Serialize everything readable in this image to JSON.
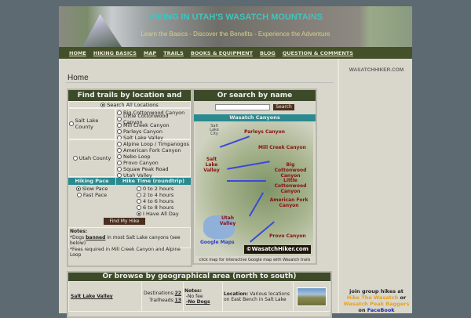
{
  "header": {
    "title": "HIKING IN UTAH'S WASATCH MOUNTAINS",
    "tagline": "Learn the Basics - Discover the Benefits - Experience the Adventure"
  },
  "nav": [
    "HOME",
    "HIKING BASICS",
    "MAP",
    "TRAILS",
    "BOOKS & EQUIPMENT",
    "BLOG",
    "QUESTION & COMMENTS"
  ],
  "page_title": "Home",
  "finder": {
    "title": "Find trails by location and time",
    "all": "Search All Locations",
    "slc": {
      "label": "Salt Lake County",
      "options": [
        "Big Cottonwood Canyon",
        "Little Cottonwood Canyon",
        "Mill Creek Canyon",
        "Parleys Canyon",
        "Salt Lake Valley"
      ]
    },
    "utah": {
      "label": "Utah County",
      "options": [
        "Alpine Loop / Timpanogos",
        "American Fork Canyon",
        "Nebo Loop",
        "Provo Canyon",
        "Squaw Peak Road",
        "Utah Valley"
      ]
    },
    "pace_header": "Hiking Pace",
    "pace": [
      "Slow Pace",
      "Fast Pace"
    ],
    "time_header": "Hike Time (roundtrip)",
    "times": [
      "0 to 2 hours",
      "2 to 4 hours",
      "4 to 6 hours",
      "6 to 8 hours",
      "I Have All Day"
    ],
    "button": "Find My Hike",
    "notes_label": "Notes:",
    "note1_pre": "*Dogs ",
    "note1_bold": "banned",
    "note1_post": " in most Salt Lake canyons (see below)",
    "note2": "*Fees required in Mill Creek Canyon and Alpine Loop"
  },
  "search": {
    "title": "Or search by name",
    "button": "Search",
    "value": ""
  },
  "map": {
    "title": "Wasatch Canyons",
    "labels": [
      "Parleys Canyon",
      "Mill Creek Canyon",
      "Big Cottonwood Canyon",
      "Little Cottonwood Canyon",
      "American Fork Canyon",
      "Salt Lake Valley",
      "Utah Valley",
      "Provo Canyon",
      "Salt Lake City"
    ],
    "google": "Google Maps",
    "watermark": "©WasatchHiker.com",
    "caption": "click map for interactive Google map with Wasatch trails"
  },
  "browse": {
    "title": "Or browse by geographical area (north to south)",
    "rows": [
      {
        "area": "Salt Lake Valley",
        "dest_label": "Destinations:",
        "dest": "22",
        "th_label": "Trailheads:",
        "th": "13",
        "notes_label": "Notes:",
        "note1": "-No fee",
        "note2": "-No Dogs",
        "loc_label": "Location:",
        "loc": " Various locations on East Bench in Salt Lake"
      }
    ]
  },
  "sidebar": {
    "site": "WASATCHHIKER.COM",
    "promo1": "join group hikes at",
    "link1": "Hike The Wasatch",
    "or": " or",
    "link2": "Wasatch Peak Baggers",
    "on": "on ",
    "fb": "FaceBook"
  }
}
